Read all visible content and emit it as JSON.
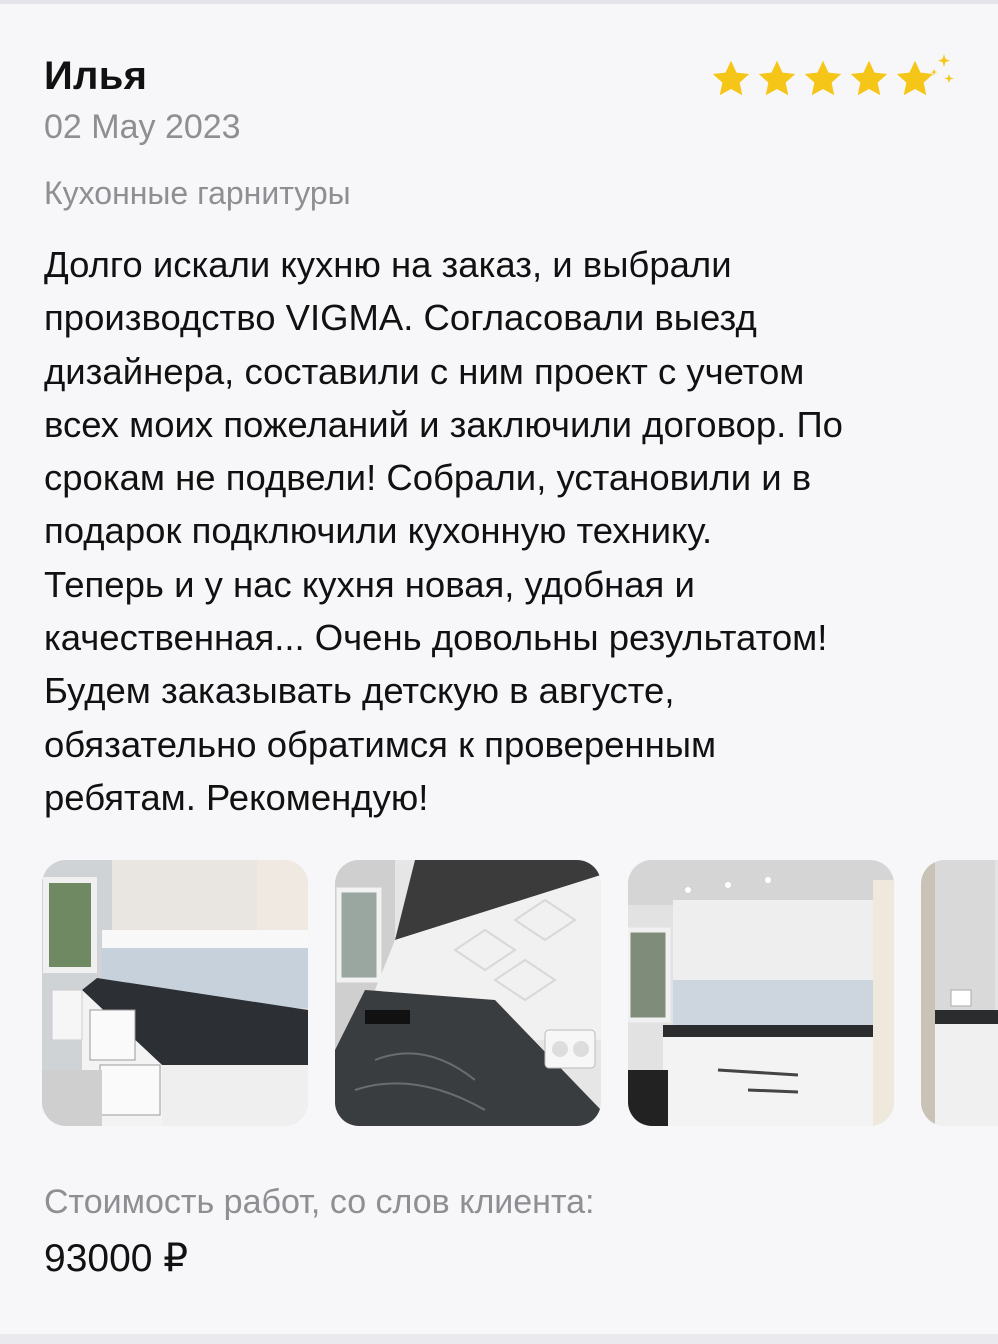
{
  "review": {
    "author": "Илья",
    "date": "02 May 2023",
    "rating": 5,
    "category": "Кухонные гарнитуры",
    "text": "Долго искали кухню на заказ, и выбрали\nпроизводство VIGMA. Согласовали выезд\nдизайнера, составили с ним проект с учетом\nвсех моих пожеланий и заключили договор. По\nсрокам не подвели! Собрали, установили и в\nподарок подключили кухонную технику.\nТеперь и у нас кухня новая, удобная и\nкачественная... Очень довольны результатом!\nБудем заказывать детскую в августе,\nобязательно обратимся к проверенным\nребятам. Рекомендую!",
    "photos": [
      {
        "icon": "kitchen-photo-1"
      },
      {
        "icon": "kitchen-photo-2"
      },
      {
        "icon": "kitchen-photo-3"
      },
      {
        "icon": "kitchen-photo-4"
      }
    ],
    "cost_label": "Стоимость работ, со слов клиента:",
    "cost_value": "93000 ₽"
  },
  "colors": {
    "star": "#f5c518",
    "muted_text": "#8e8e93",
    "background": "#f7f7f9"
  }
}
